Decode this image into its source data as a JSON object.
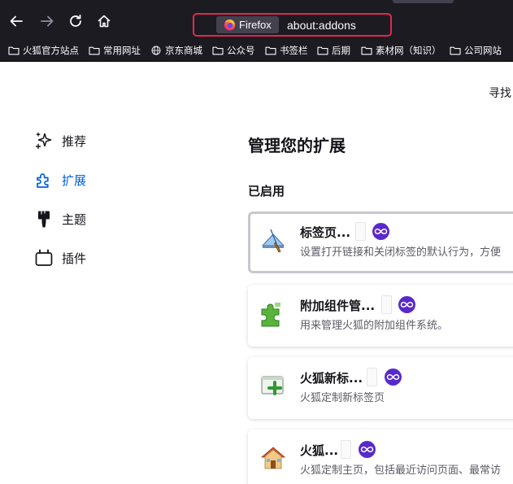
{
  "browser": {
    "identity_label": "Firefox",
    "url": "about:addons"
  },
  "bookmarks": [
    {
      "label": "火狐官方站点",
      "icon": "folder-icon"
    },
    {
      "label": "常用网址",
      "icon": "folder-icon"
    },
    {
      "label": "京东商城",
      "icon": "globe-icon"
    },
    {
      "label": "公众号",
      "icon": "folder-icon"
    },
    {
      "label": "书签栏",
      "icon": "folder-icon"
    },
    {
      "label": "后期",
      "icon": "folder-icon"
    },
    {
      "label": "素材网（知识）",
      "icon": "folder-icon"
    },
    {
      "label": "公司网站",
      "icon": "folder-icon"
    }
  ],
  "header": {
    "search_label": "寻找"
  },
  "categories": [
    {
      "label": "推荐",
      "icon": "sparkle-icon"
    },
    {
      "label": "扩展",
      "icon": "puzzle-icon"
    },
    {
      "label": "主题",
      "icon": "brush-icon"
    },
    {
      "label": "插件",
      "icon": "plugin-icon"
    }
  ],
  "main": {
    "heading": "管理您的扩展",
    "section_enabled": "已启用",
    "addons": [
      {
        "name": "标签页...",
        "description": "设置打开链接和关闭标签的默认行为，方便",
        "icon": "tab-brush-icon"
      },
      {
        "name": "附加组件管...",
        "description": "用来管理火狐的附加组件系统。",
        "icon": "green-puzzle-icon"
      },
      {
        "name": "火狐新标...",
        "description": "火狐定制新标签页",
        "icon": "new-tab-plus-icon"
      },
      {
        "name": "火狐...",
        "description": "火狐定制主页，包括最近访问页面、最常访",
        "icon": "house-icon"
      }
    ]
  },
  "colors": {
    "accent": "#0061e0",
    "badge": "#592acb",
    "url_highlight": "#e22850"
  }
}
